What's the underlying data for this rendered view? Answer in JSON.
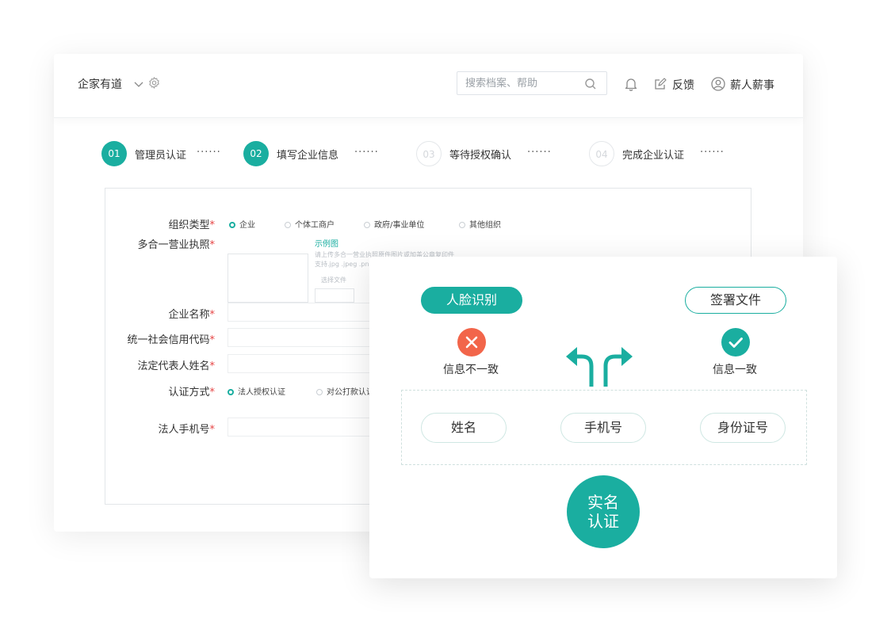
{
  "header": {
    "brand": "企家有道",
    "search_placeholder": "搜索档案、帮助",
    "feedback_label": "反馈",
    "user_label": "薪人薪事"
  },
  "steps": [
    {
      "num": "01",
      "label": "管理员认证",
      "active": true
    },
    {
      "num": "02",
      "label": "填写企业信息",
      "active": true
    },
    {
      "num": "03",
      "label": "等待授权确认",
      "active": false
    },
    {
      "num": "04",
      "label": "完成企业认证",
      "active": false
    }
  ],
  "step_dots": "······",
  "form": {
    "org_type_label": "组织类型",
    "org_types": [
      "企业",
      "个体工商户",
      "政府/事业单位",
      "其他组织"
    ],
    "selected_org_type": "企业",
    "license_label": "多合一营业执照",
    "sample_link": "示例图",
    "upload_hint_1": "请上传多合一营业执照原件图片或加盖公章复印件",
    "upload_hint_2": "支持.jpg .jpeg .png",
    "choose_file": "选择文件",
    "company_name_label": "企业名称",
    "credit_code_label": "统一社会信用代码",
    "legal_rep_label": "法定代表人姓名",
    "auth_method_label": "认证方式",
    "auth_methods": [
      "法人授权认证",
      "对公打款认证"
    ],
    "selected_auth_method": "法人授权认证",
    "legal_phone_label": "法人手机号",
    "required_mark": "*"
  },
  "overlay": {
    "face_recognition": "人脸识别",
    "sign_document": "签署文件",
    "mismatch": "信息不一致",
    "match": "信息一致",
    "fields": [
      "姓名",
      "手机号",
      "身份证号"
    ],
    "center_line1": "实名",
    "center_line2": "认证"
  },
  "colors": {
    "accent": "#1aaea0",
    "error": "#f2654a",
    "required": "#e64545"
  }
}
